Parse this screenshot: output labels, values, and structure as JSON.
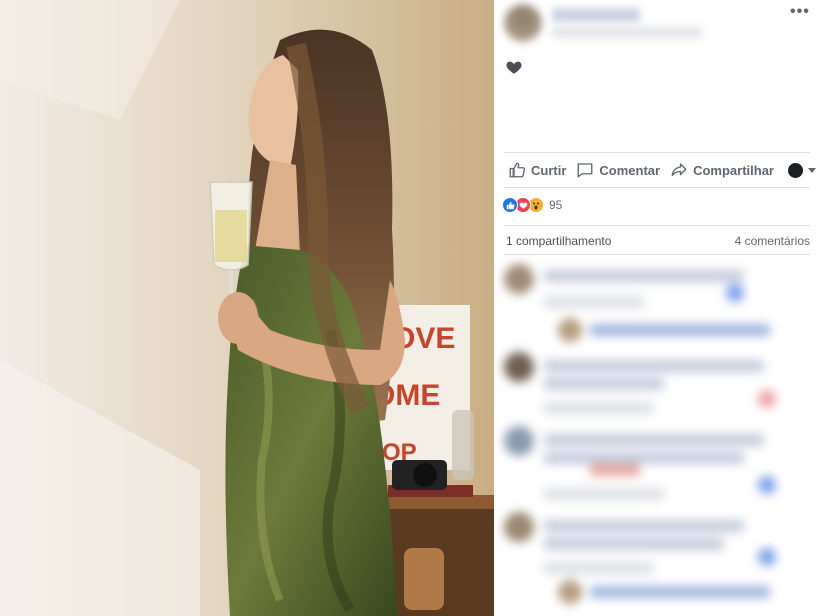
{
  "post": {
    "author_name": "",
    "meta": "",
    "more_label": "•••",
    "body_icon": "heart-icon"
  },
  "actions": {
    "like_label": "Curtir",
    "comment_label": "Comentar",
    "share_label": "Compartilhar",
    "audience_icon": "globe-icon"
  },
  "reactions": {
    "types": [
      "like",
      "love",
      "wow"
    ],
    "count": "95"
  },
  "stats": {
    "shares": "1 compartilhamento",
    "comments": "4 comentários"
  },
  "colors": {
    "like_blue": "#1877f2",
    "love_red": "#f33e58",
    "wow_yellow": "#f7b125",
    "secondary_text": "#606770",
    "divider": "#dddfe2"
  }
}
